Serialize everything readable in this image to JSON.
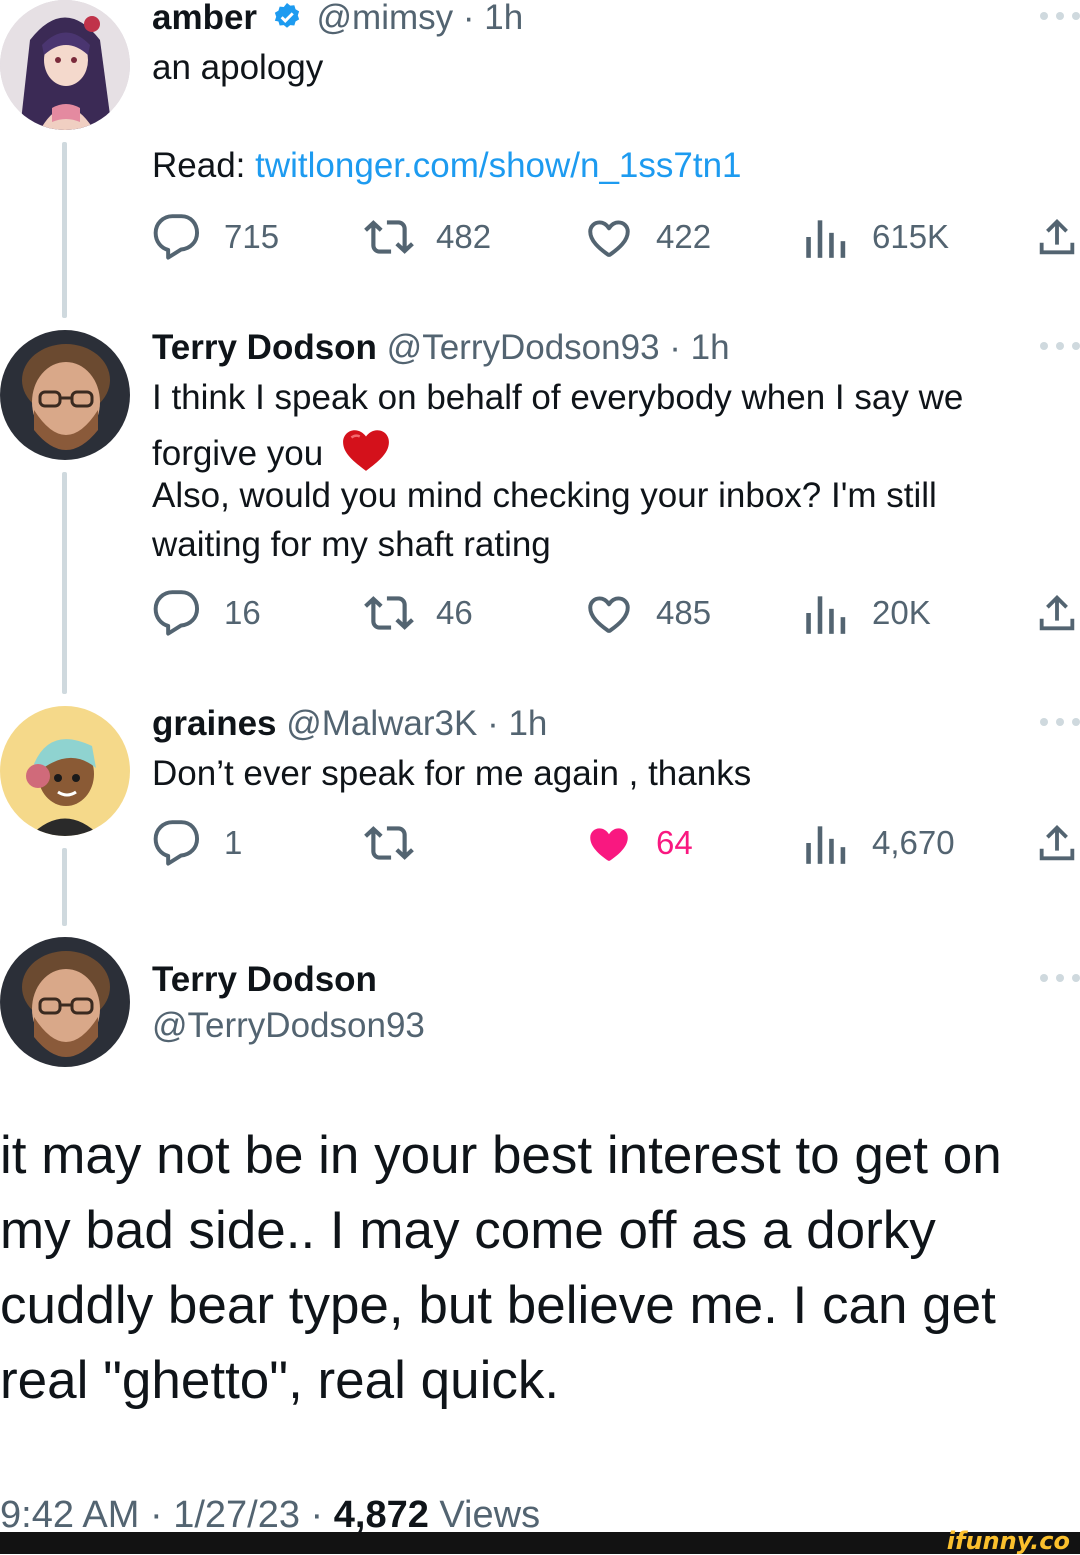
{
  "tweets": [
    {
      "name": "amber",
      "verified": true,
      "handle_time": "@mimsy · 1h",
      "text_lines": [
        "an apology"
      ],
      "read_label": "Read:",
      "link": "twitlonger.com/show/n_1ss7tn1",
      "stats": {
        "replies": "715",
        "retweets": "482",
        "likes": "422",
        "views": "615K"
      },
      "liked": false,
      "avatar_icon": "anime-girl-avatar"
    },
    {
      "name": "Terry Dodson",
      "handle_time": "@TerryDodson93 · 1h",
      "text_lines": [
        "I think I speak on behalf of everybody when I say we",
        "forgive you",
        "Also, would you mind checking your inbox? I'm still",
        "waiting for my shaft rating"
      ],
      "emoji": "❤️",
      "stats": {
        "replies": "16",
        "retweets": "46",
        "likes": "485",
        "views": "20K"
      },
      "liked": false,
      "avatar_icon": "man-with-glasses-avatar"
    },
    {
      "name": "graines",
      "handle_time": "@Malwar3K · 1h",
      "text_lines": [
        "Don’t ever speak for me again , thanks"
      ],
      "stats": {
        "replies": "1",
        "retweets": "",
        "likes": "64",
        "views": "4,670"
      },
      "liked": true,
      "avatar_icon": "cartoon-headphones-avatar"
    }
  ],
  "main_tweet": {
    "name": "Terry Dodson",
    "handle": "@TerryDodson93",
    "text": "it may not be in your best interest to get on my bad side.. I may come off as a dorky cuddly bear type, but believe me. I can get real \"ghetto\", real quick.",
    "time_date": "9:42 AM · 1/27/23 · ",
    "views_count": "4,872",
    "views_label": " Views"
  },
  "watermark": "ifunny.co",
  "colors": {
    "accent": "#1d9bf0",
    "like": "#f91880",
    "muted": "#536471",
    "thread_line": "#cfd9de"
  }
}
